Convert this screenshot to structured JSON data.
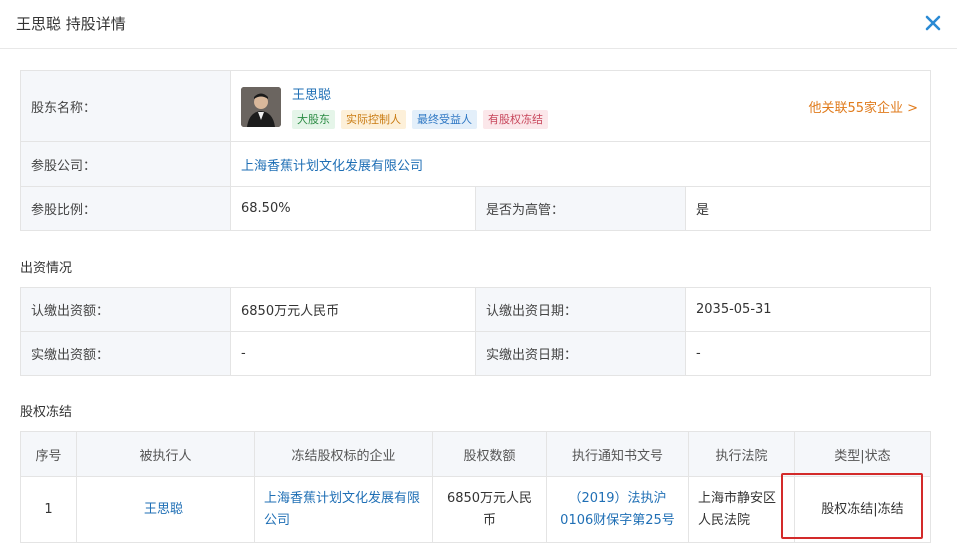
{
  "dialog": {
    "title": "王思聪 持股详情",
    "close_icon": "close-icon"
  },
  "shareholder": {
    "label": "股东名称：",
    "name": "王思聪",
    "tags": [
      "大股东",
      "实际控制人",
      "最终受益人",
      "有股权冻结"
    ],
    "related_link": "他关联55家企业 >"
  },
  "company": {
    "label": "参股公司：",
    "value": "上海香蕉计划文化发展有限公司"
  },
  "ratio": {
    "label": "参股比例：",
    "value": "68.50%",
    "exec_label": "是否为高管：",
    "exec_value": "是"
  },
  "investment": {
    "title": "出资情况",
    "subscribed_label": "认缴出资额：",
    "subscribed_value": "6850万元人民币",
    "subscribed_date_label": "认缴出资日期：",
    "subscribed_date_value": "2035-05-31",
    "paid_label": "实缴出资额：",
    "paid_value": "-",
    "paid_date_label": "实缴出资日期：",
    "paid_date_value": "-"
  },
  "freeze": {
    "title": "股权冻结",
    "headers": [
      "序号",
      "被执行人",
      "冻结股权标的企业",
      "股权数额",
      "执行通知书文号",
      "执行法院",
      "类型|状态"
    ],
    "rows": [
      {
        "index": "1",
        "executee": "王思聪",
        "company": "上海香蕉计划文化发展有限公司",
        "amount": "6850万元人民币",
        "notice_no": "（2019）法执沪0106财保字第25号",
        "court": "上海市静安区人民法院",
        "status": "股权冻结|冻结"
      }
    ]
  }
}
